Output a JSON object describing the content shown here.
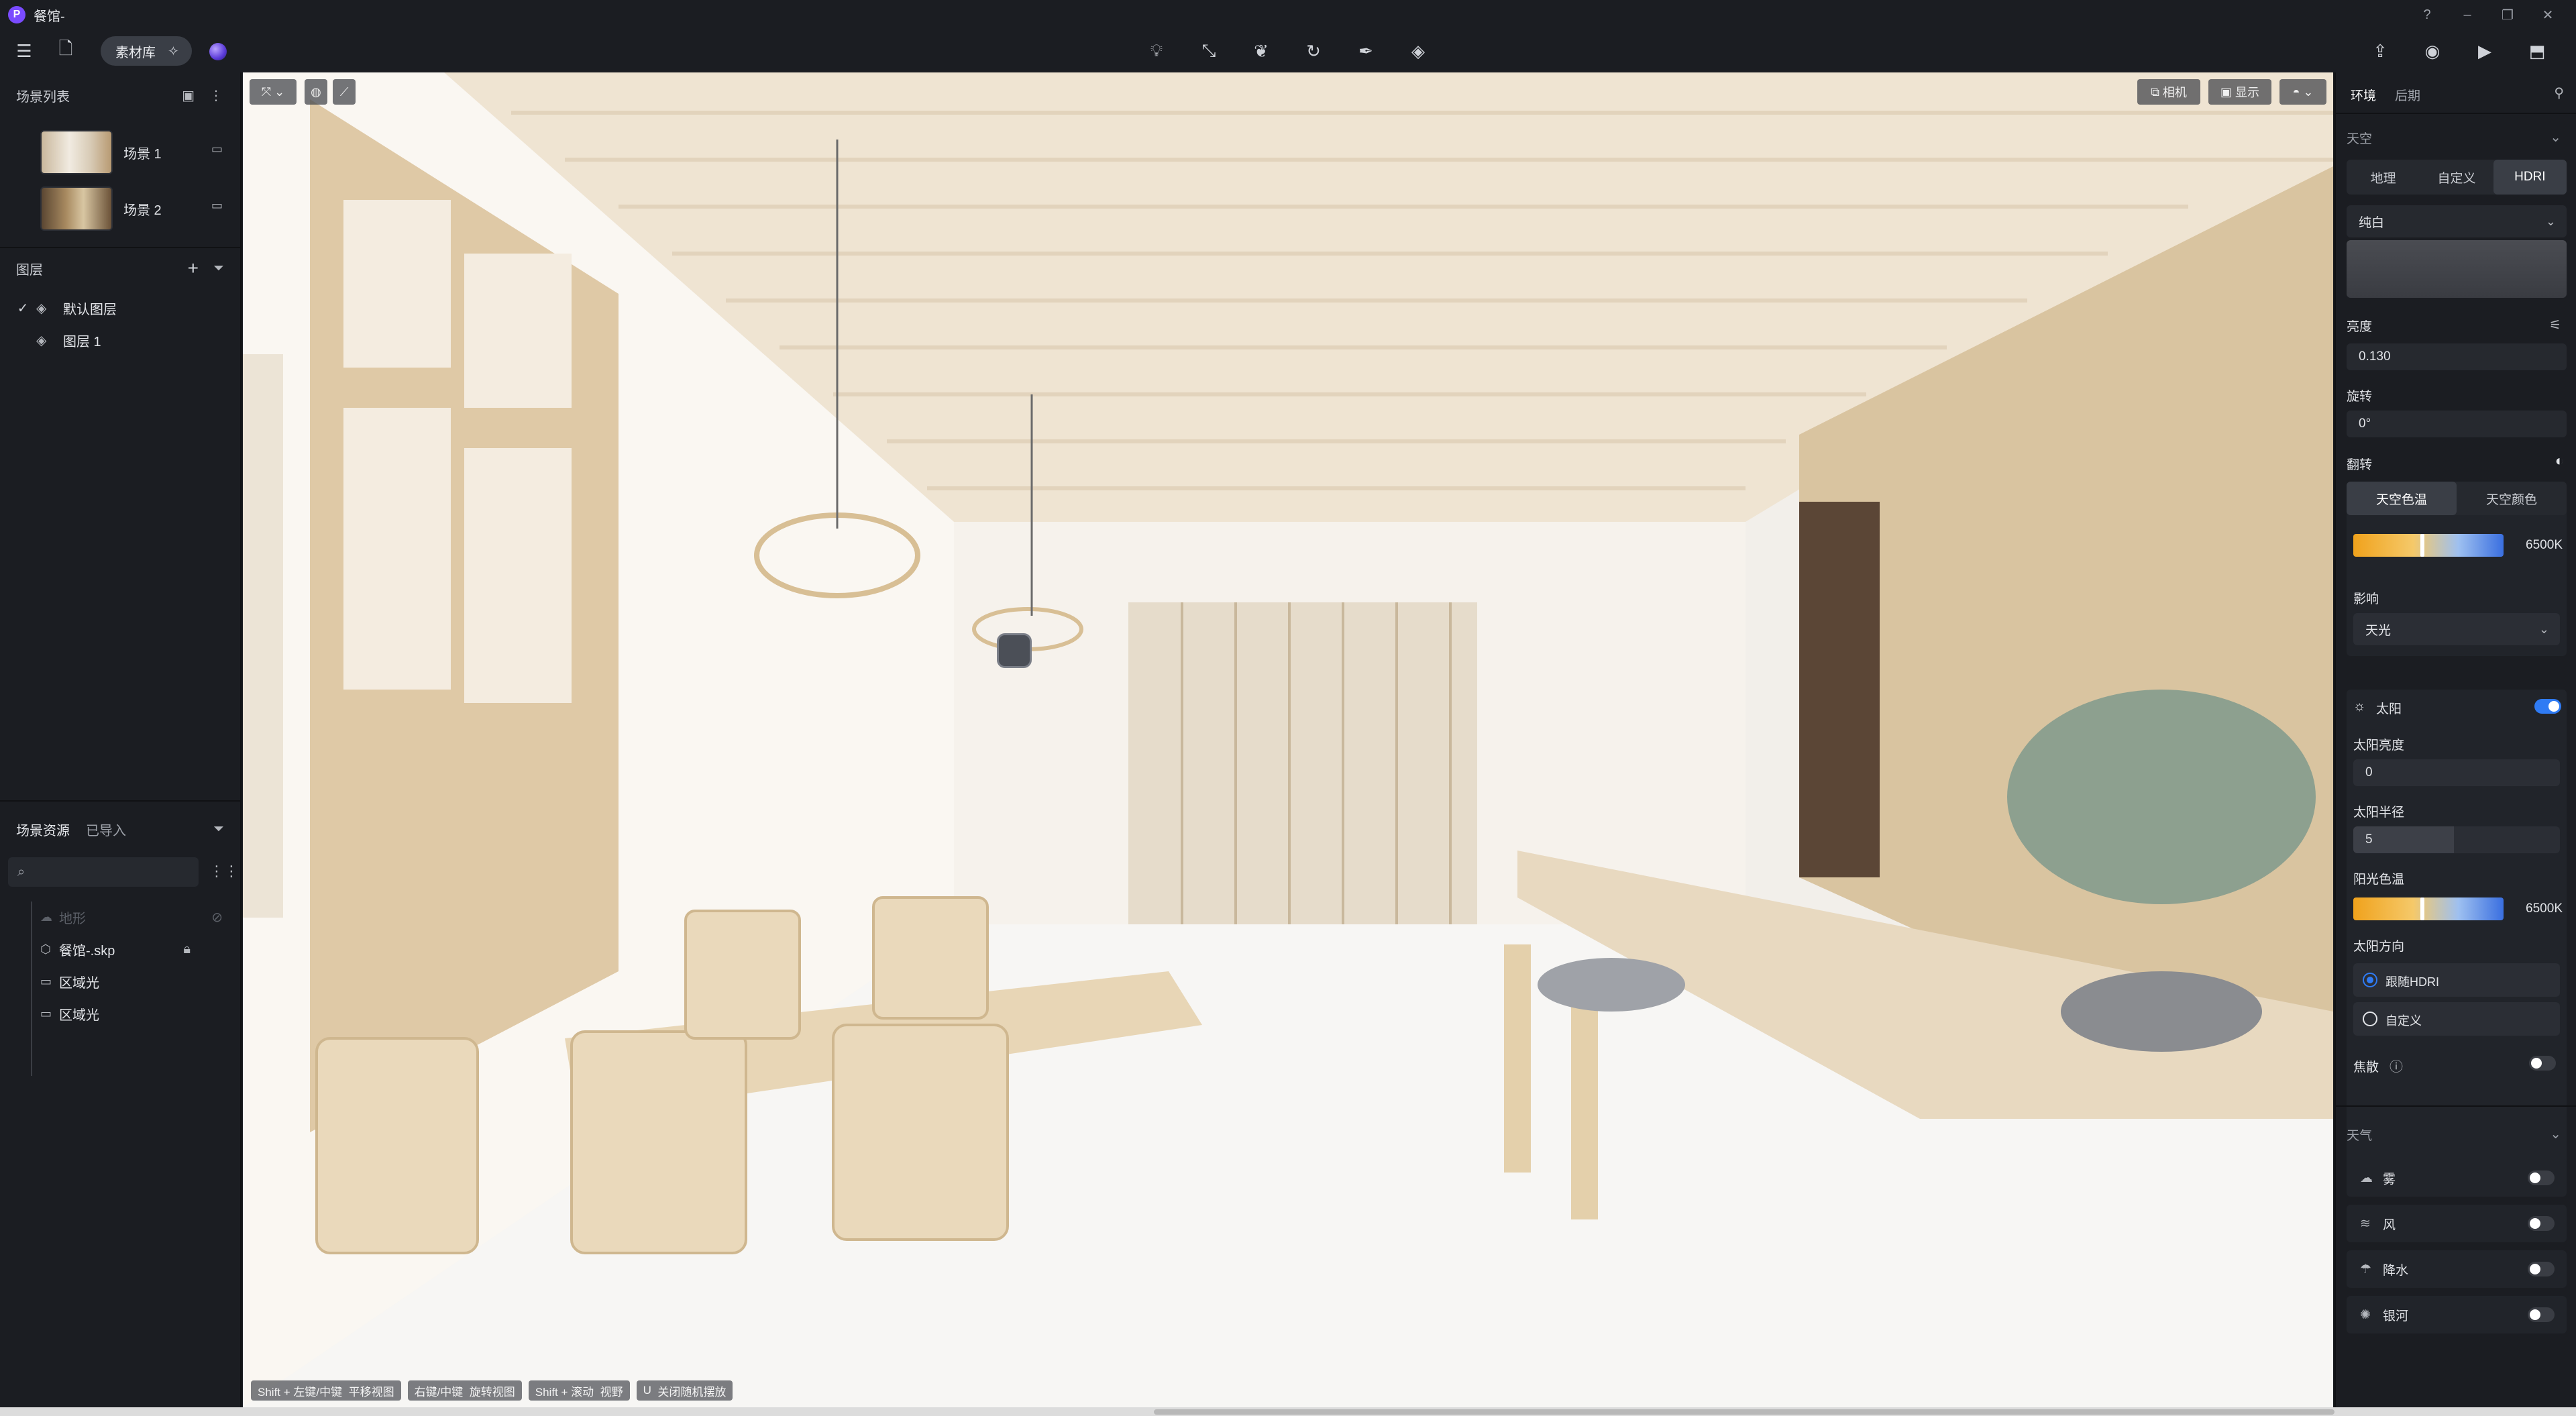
{
  "window": {
    "title": "餐馆-",
    "logo_letter": "P"
  },
  "toolbar": {
    "library_label": "素材库",
    "center_tools": [
      "light-icon",
      "path-icon",
      "leaf-icon",
      "rotate-icon",
      "pen-icon",
      "layers-icon"
    ],
    "right_tools": [
      "export-icon",
      "camera-icon",
      "video-icon",
      "save-icon"
    ]
  },
  "scene_list": {
    "title": "场景列表",
    "items": [
      {
        "label": "场景 1"
      },
      {
        "label": "场景 2"
      }
    ]
  },
  "layers": {
    "title": "图层",
    "items": [
      {
        "label": "默认图层",
        "checked": true
      },
      {
        "label": "图层 1",
        "checked": false
      }
    ]
  },
  "resources": {
    "tabs": [
      "场景资源",
      "已导入"
    ],
    "search_placeholder": "",
    "items": [
      {
        "label": "地形",
        "icon": "terrain-icon",
        "disabled": true
      },
      {
        "label": "餐馆-.skp",
        "icon": "cube-icon",
        "disabled": false
      },
      {
        "label": "区域光",
        "icon": "area-light-icon",
        "disabled": false
      },
      {
        "label": "区域光",
        "icon": "area-light-icon",
        "disabled": false
      }
    ]
  },
  "viewport": {
    "top_right_buttons": [
      "相机",
      "显示"
    ],
    "hints": [
      {
        "key": "Shift + 左键/中键",
        "action": "平移视图"
      },
      {
        "key": "右键/中键",
        "action": "旋转视图"
      },
      {
        "key": "Shift + 滚动",
        "action": "视野"
      },
      {
        "key": "U",
        "action": "关闭随机摆放"
      }
    ]
  },
  "environment": {
    "tabs": [
      "环境",
      "后期"
    ],
    "sky_title": "天空",
    "sky_modes": [
      "地理",
      "自定义",
      "HDRI"
    ],
    "sky_mode_selected": "HDRI",
    "hdri_preset": "纯白",
    "brightness_label": "亮度",
    "brightness_value": "0.130",
    "rotation_label": "旋转",
    "rotation_value": "0°",
    "flip_label": "翻转",
    "sky_color_tabs": [
      "天空色温",
      "天空颜色"
    ],
    "sky_temp_value": "6500K",
    "influence_label": "影响",
    "influence_value": "天光",
    "sun_label": "太阳",
    "sun_enabled": true,
    "sun_brightness_label": "太阳亮度",
    "sun_brightness_value": "0",
    "sun_radius_label": "太阳半径",
    "sun_radius_value": "5",
    "sun_temp_label": "阳光色温",
    "sun_temp_value": "6500K",
    "sun_direction_label": "太阳方向",
    "sun_direction_options": [
      "跟随HDRI",
      "自定义"
    ],
    "sun_direction_selected": "跟随HDRI",
    "caustics_label": "焦散",
    "caustics_enabled": false,
    "weather_title": "天气",
    "weather_items": [
      {
        "label": "雾",
        "icon": "fog-icon",
        "enabled": false
      },
      {
        "label": "风",
        "icon": "wind-icon",
        "enabled": false
      },
      {
        "label": "降水",
        "icon": "rain-icon",
        "enabled": false
      },
      {
        "label": "银河",
        "icon": "galaxy-icon",
        "enabled": false
      }
    ]
  },
  "colors": {
    "accent": "#2f7bf4",
    "panel_bg": "#1b1d22",
    "app_logo": "#7a4bff"
  }
}
